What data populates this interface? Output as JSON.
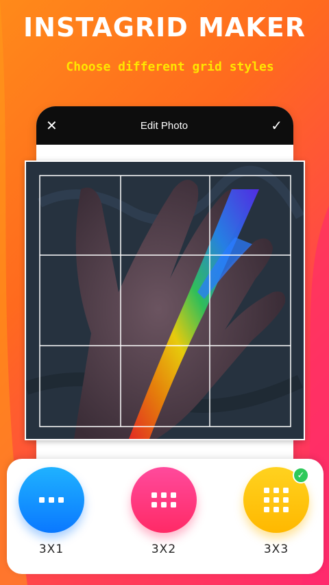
{
  "header": {
    "title": "INSTAGRID MAKER",
    "subtitle": "Choose different grid styles"
  },
  "editor": {
    "close_icon": "✕",
    "title": "Edit Photo",
    "confirm_icon": "✓"
  },
  "photo": {
    "description_icon": "image-photo",
    "grid_rows": 3,
    "grid_cols": 3
  },
  "grid_options": [
    {
      "label": "3X1",
      "color": "#0a78ff",
      "selected": false
    },
    {
      "label": "3X2",
      "color": "#ff2a66",
      "selected": false
    },
    {
      "label": "3X3",
      "color": "#ffb800",
      "selected": true
    }
  ],
  "selected_badge": "✓",
  "colors": {
    "accent_title": "#ffffff",
    "accent_subtitle": "#ffe600",
    "badge": "#2ec95a"
  }
}
